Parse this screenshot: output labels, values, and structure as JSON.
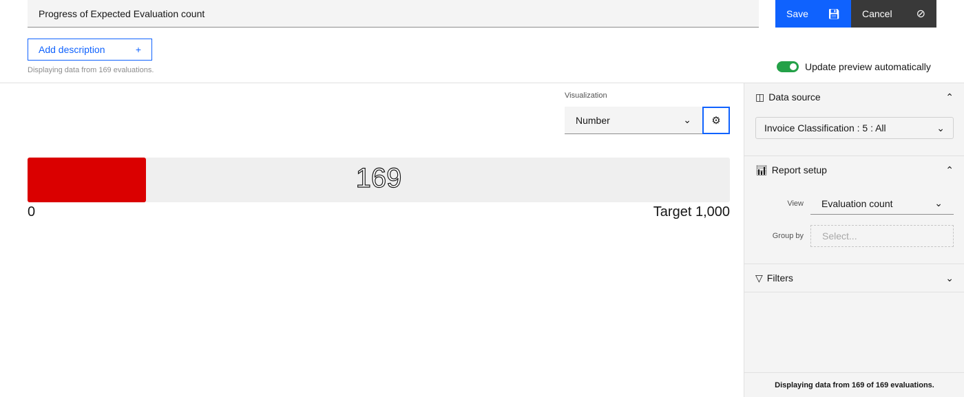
{
  "header": {
    "title_value": "Progress of Expected Evaluation count",
    "save_label": "Save",
    "cancel_label": "Cancel",
    "add_description_label": "Add description",
    "add_icon": "+",
    "hint": "Displaying data from 169 evaluations.",
    "toggle_label": "Update preview automatically",
    "toggle_on": true
  },
  "visualization": {
    "label": "Visualization",
    "selected": "Number"
  },
  "progress": {
    "value": "169",
    "min_label": "0",
    "target_label": "Target 1,000",
    "fraction": 0.169,
    "fill_color": "#da0000"
  },
  "panel": {
    "data_source": {
      "title": "Data source",
      "selected": "Invoice Classification : 5 : All"
    },
    "report_setup": {
      "title": "Report setup",
      "view_label": "View",
      "view_value": "Evaluation count",
      "group_label": "Group by",
      "group_placeholder": "Select..."
    },
    "filters": {
      "title": "Filters"
    },
    "footer": "Displaying data from 169 of 169 evaluations."
  },
  "colors": {
    "primary": "#0f62fe",
    "cancel": "#393939",
    "toggle": "#24a148"
  }
}
